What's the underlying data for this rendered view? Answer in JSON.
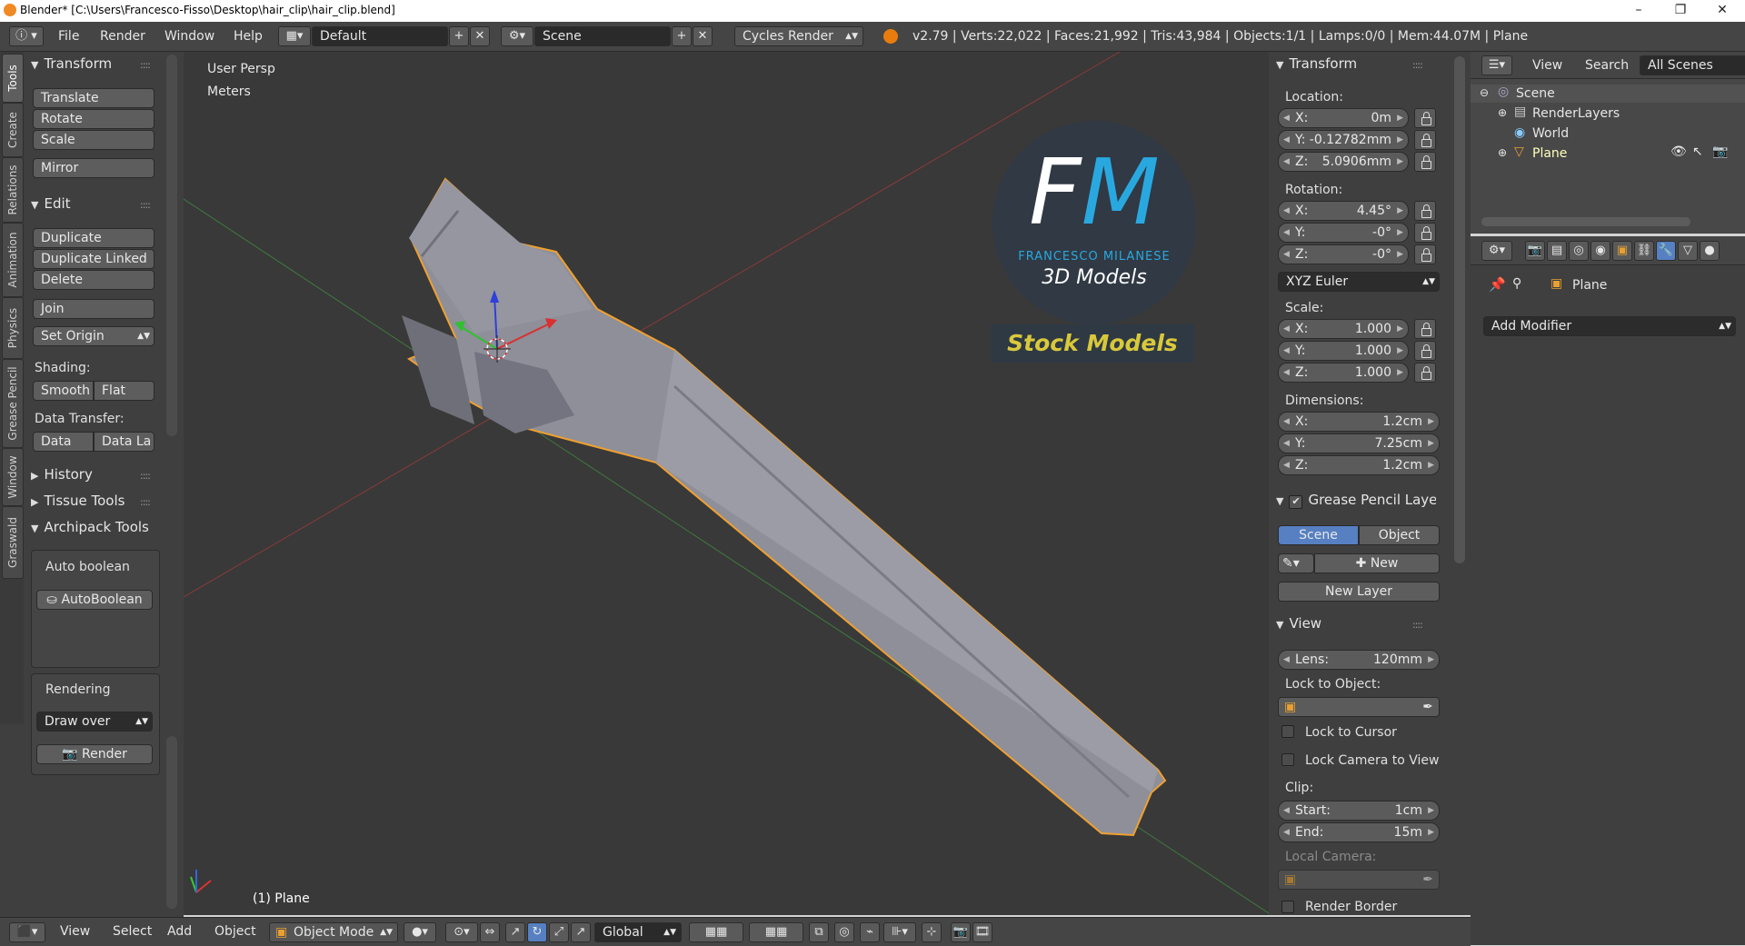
{
  "window": {
    "title": "Blender* [C:\\Users\\Francesco-Fisso\\Desktop\\hair_clip\\hair_clip.blend]",
    "controls": {
      "minimize": "–",
      "maximize": "❐",
      "close": "✕"
    }
  },
  "header": {
    "menus": [
      "File",
      "Render",
      "Window",
      "Help"
    ],
    "layout": "Default",
    "scene": "Scene",
    "engine": "Cycles Render",
    "stats": "v2.79 | Verts:22,022 | Faces:21,992 | Tris:43,984 | Objects:1/1 | Lamps:0/0 | Mem:44.07M | Plane"
  },
  "tabs": [
    "Tools",
    "Create",
    "Relations",
    "Animation",
    "Physics",
    "Grease Pencil",
    "Window",
    "Graswald"
  ],
  "toolshelf": {
    "transform": {
      "title": "Transform",
      "buttons": [
        "Translate",
        "Rotate",
        "Scale",
        "Mirror"
      ]
    },
    "edit": {
      "title": "Edit",
      "buttons": [
        "Duplicate",
        "Duplicate Linked",
        "Delete",
        "Join"
      ],
      "set_origin": "Set Origin"
    },
    "shading": {
      "label": "Shading:",
      "smooth": "Smooth",
      "flat": "Flat"
    },
    "data_transfer": {
      "label": "Data Transfer:",
      "data": "Data",
      "data_layers": "Data La"
    },
    "history": "History",
    "tissue": "Tissue Tools",
    "archipack": "Archipack Tools",
    "auto_boolean_label": "Auto boolean",
    "auto_boolean_btn": "AutoBoolean",
    "rendering_label": "Rendering",
    "draw_over": "Draw over",
    "render_btn": "Render"
  },
  "viewport": {
    "view_name": "User Persp",
    "units": "Meters",
    "object_label": "(1) Plane",
    "watermark": {
      "big": "FM",
      "name": "FRANCESCO MILANESE",
      "sub": "3D Models",
      "stock": "Stock Models"
    }
  },
  "properties": {
    "transform_title": "Transform",
    "location_label": "Location:",
    "location": [
      {
        "k": "X:",
        "v": "0m"
      },
      {
        "k": "Y:",
        "v": "-0.12782mm"
      },
      {
        "k": "Z:",
        "v": "5.0906mm"
      }
    ],
    "rotation_label": "Rotation:",
    "rotation": [
      {
        "k": "X:",
        "v": "4.45°"
      },
      {
        "k": "Y:",
        "v": "-0°"
      },
      {
        "k": "Z:",
        "v": "-0°"
      }
    ],
    "rotation_mode": "XYZ Euler",
    "scale_label": "Scale:",
    "scale": [
      {
        "k": "X:",
        "v": "1.000"
      },
      {
        "k": "Y:",
        "v": "1.000"
      },
      {
        "k": "Z:",
        "v": "1.000"
      }
    ],
    "dimensions_label": "Dimensions:",
    "dimensions": [
      {
        "k": "X:",
        "v": "1.2cm"
      },
      {
        "k": "Y:",
        "v": "7.25cm"
      },
      {
        "k": "Z:",
        "v": "1.2cm"
      }
    ],
    "grease_title": "Grease Pencil Layer",
    "scene_tab": "Scene",
    "object_tab": "Object",
    "new_btn": "New",
    "new_layer_btn": "New Layer",
    "view_title": "View",
    "lens": {
      "k": "Lens:",
      "v": "120mm"
    },
    "lock_to_object": "Lock to Object:",
    "lock_to_cursor": "Lock to Cursor",
    "lock_camera": "Lock Camera to View",
    "clip_label": "Clip:",
    "clip_start": {
      "k": "Start:",
      "v": "1cm"
    },
    "clip_end": {
      "k": "End:",
      "v": "15m"
    },
    "local_camera": "Local Camera:",
    "render_border": "Render Border"
  },
  "outliner": {
    "view": "View",
    "search": "Search",
    "filter": "All Scenes",
    "items": [
      "Scene",
      "RenderLayers",
      "World",
      "Plane"
    ]
  },
  "props_editor": {
    "breadcrumb": "Plane",
    "add_modifier": "Add Modifier"
  },
  "bottombar": {
    "menus": [
      "View",
      "Select",
      "Add",
      "Object"
    ],
    "mode": "Object Mode",
    "orientation": "Global"
  },
  "colors": {
    "accent": "#5680c2",
    "selection_outline": "#f0a030",
    "mesh": "#8e8f99",
    "stock_text": "#d9c83a",
    "fm_blue": "#29a8e0"
  }
}
